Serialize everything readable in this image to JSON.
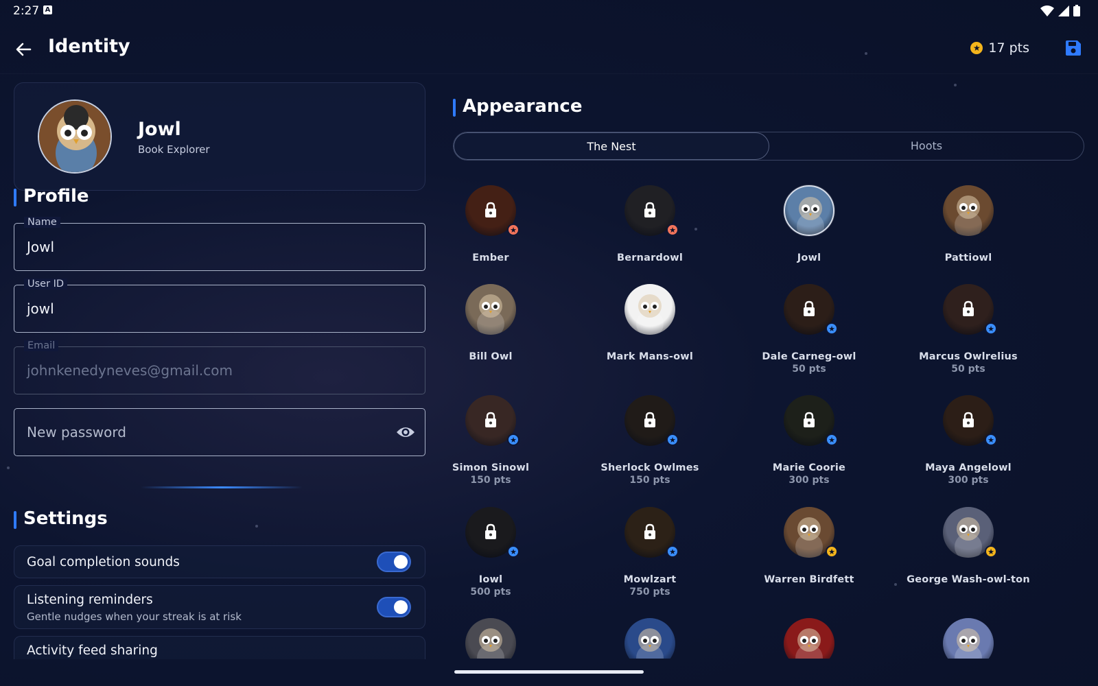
{
  "status": {
    "time": "2:27",
    "indicator": "A"
  },
  "appbar": {
    "title": "Identity",
    "points": "17 pts"
  },
  "profile_card": {
    "name": "Jowl",
    "subtitle": "Book Explorer"
  },
  "profile": {
    "title": "Profile",
    "name_label": "Name",
    "name_value": "Jowl",
    "userid_label": "User ID",
    "userid_value": "jowl",
    "email_label": "Email",
    "email_value": "johnkenedyneves@gmail.com",
    "password_placeholder": "New password"
  },
  "settings": {
    "title": "Settings",
    "items": [
      {
        "title": "Goal completion sounds",
        "desc": "",
        "on": true
      },
      {
        "title": "Listening reminders",
        "desc": "Gentle nudges when your streak is at risk",
        "on": true
      },
      {
        "title": "Activity feed sharing",
        "desc": ""
      }
    ]
  },
  "appearance": {
    "title": "Appearance",
    "tabs": [
      "The Nest",
      "Hoots"
    ],
    "active_tab": 0,
    "avatars": [
      {
        "name": "Ember",
        "pts": "",
        "locked": true,
        "badge": "red",
        "color": "#5a2a1c"
      },
      {
        "name": "Bernardowl",
        "pts": "",
        "locked": true,
        "badge": "red",
        "color": "#2a2a30"
      },
      {
        "name": "Jowl",
        "pts": "",
        "locked": false,
        "badge": "",
        "color": "#5c7fa8",
        "selected": true
      },
      {
        "name": "Pattiowl",
        "pts": "",
        "locked": false,
        "badge": "",
        "color": "#6b4a30"
      },
      {
        "name": "Bill Owl",
        "pts": "",
        "locked": false,
        "badge": "",
        "color": "#7a6a58"
      },
      {
        "name": "Mark Mans-owl",
        "pts": "",
        "locked": false,
        "badge": "",
        "color": "#f2f2f2"
      },
      {
        "name": "Dale Carneg-owl",
        "pts": "50 pts",
        "locked": true,
        "badge": "blue",
        "color": "#3a2820"
      },
      {
        "name": "Marcus Owlrelius",
        "pts": "50 pts",
        "locked": true,
        "badge": "blue",
        "color": "#3e2a26"
      },
      {
        "name": "Simon Sinowl",
        "pts": "150 pts",
        "locked": true,
        "badge": "blue",
        "color": "#4a3430"
      },
      {
        "name": "Sherlock Owlmes",
        "pts": "150 pts",
        "locked": true,
        "badge": "blue",
        "color": "#2a2420"
      },
      {
        "name": "Marie Coorie",
        "pts": "300 pts",
        "locked": true,
        "badge": "blue",
        "color": "#262a22"
      },
      {
        "name": "Maya Angelowl",
        "pts": "300 pts",
        "locked": true,
        "badge": "blue",
        "color": "#3a281e"
      },
      {
        "name": "Iowl",
        "pts": "500 pts",
        "locked": true,
        "badge": "blue",
        "color": "#222226"
      },
      {
        "name": "Mowlzart",
        "pts": "750 pts",
        "locked": true,
        "badge": "blue",
        "color": "#3a2c1e"
      },
      {
        "name": "Warren Birdfett",
        "pts": "",
        "locked": false,
        "badge": "gold",
        "color": "#6a4a32"
      },
      {
        "name": "George Wash-owl-ton",
        "pts": "",
        "locked": false,
        "badge": "gold",
        "color": "#5a6078"
      },
      {
        "name": "",
        "pts": "",
        "locked": false,
        "badge": "",
        "color": "#4a4a52"
      },
      {
        "name": "",
        "pts": "",
        "locked": false,
        "badge": "",
        "color": "#2a4a8a"
      },
      {
        "name": "",
        "pts": "",
        "locked": false,
        "badge": "",
        "color": "#8a1a1a"
      },
      {
        "name": "",
        "pts": "",
        "locked": false,
        "badge": "",
        "color": "#6a7ab0"
      }
    ]
  }
}
